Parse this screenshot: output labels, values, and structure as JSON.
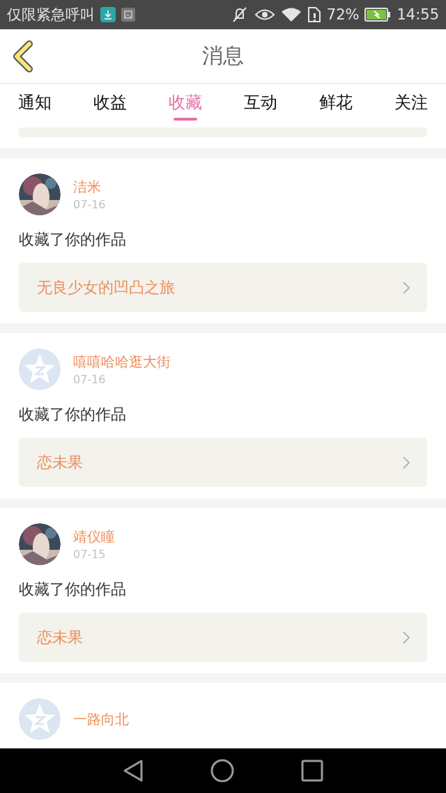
{
  "status_bar": {
    "notice": "仅限紧急呼叫",
    "battery": "72%",
    "time": "14:55"
  },
  "header": {
    "title": "消息"
  },
  "tabs": [
    {
      "label": "通知",
      "selected": false
    },
    {
      "label": "收益",
      "selected": false
    },
    {
      "label": "收藏",
      "selected": true
    },
    {
      "label": "互动",
      "selected": false
    },
    {
      "label": "鲜花",
      "selected": false
    },
    {
      "label": "关注",
      "selected": false
    }
  ],
  "messages": [
    {
      "name": "洁米",
      "date": "07-16",
      "action": "收藏了你的作品",
      "work": "无良少女的凹凸之旅"
    },
    {
      "avatar": {
        "kind": "default"
      },
      "name": "嘻嘻哈哈逛大街",
      "date": "07-16",
      "action": "收藏了你的作品",
      "work": "恋未果"
    },
    {
      "name": "靖仪瞳",
      "date": "07-15",
      "action": "收藏了你的作品",
      "work": "恋未果"
    },
    {
      "avatar": {
        "kind": "default"
      },
      "name": "一路向北"
    }
  ]
}
